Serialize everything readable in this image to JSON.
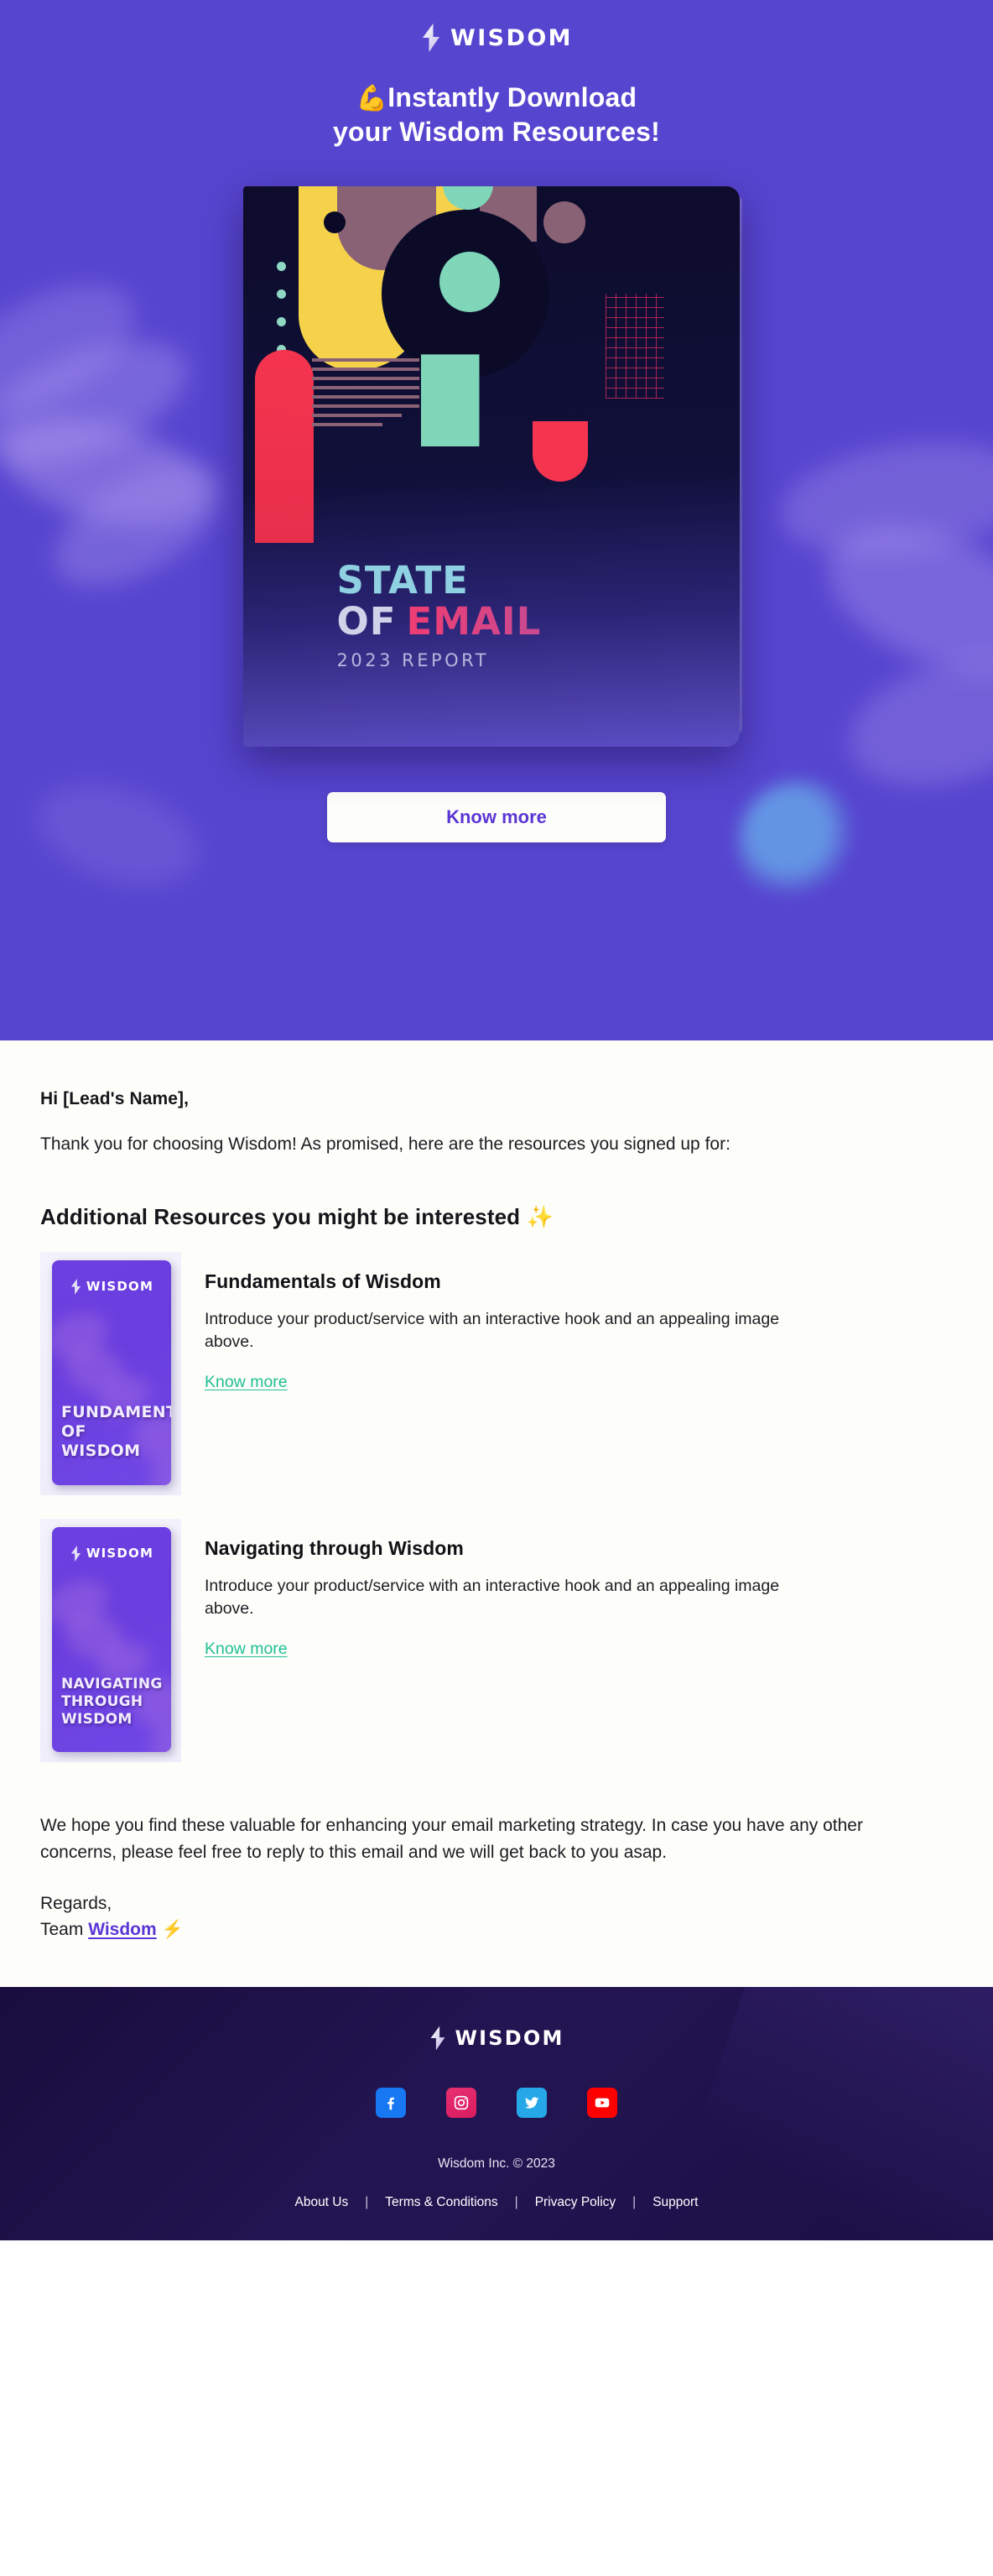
{
  "brand": {
    "name": "WISDOM",
    "accent": "#5645cf",
    "cta_text_color": "#5b36d6",
    "link_green": "#1fbf93",
    "footer_bg": "#1d1046"
  },
  "hero": {
    "logo_word": "WISDOM",
    "logo_icon": "lightning-bolt-icon",
    "headline_emoji": "💪",
    "headline_line1": "Instantly Download",
    "headline_line2": "your Wisdom Resources!",
    "book": {
      "title_line1": "STATE",
      "title_of": "OF",
      "title_email": "EMAIL",
      "subtitle": "2023 REPORT"
    },
    "cta_label": "Know more"
  },
  "body": {
    "greeting": "Hi [Lead's Name],",
    "intro": "Thank you for choosing Wisdom! As promised, here are the resources you signed up for:",
    "section_heading": "Additional Resources you might be interested",
    "section_heading_emoji": "✨",
    "resources": [
      {
        "thumb_logo_word": "WISDOM",
        "thumb_title_line1": "FUNDAMENTALS",
        "thumb_title_line2": "OF WISDOM",
        "title": "Fundamentals of Wisdom",
        "description": "Introduce your product/service with an interactive hook and an appealing image above.",
        "link_label": "Know more"
      },
      {
        "thumb_logo_word": "WISDOM",
        "thumb_title_line1": "NAVIGATING",
        "thumb_title_line2": "THROUGH WISDOM",
        "title": "Navigating through Wisdom",
        "description": "Introduce your product/service with an interactive hook and an appealing image above.",
        "link_label": "Know more"
      }
    ],
    "outro": "We hope you find these valuable for enhancing your email marketing strategy. In case you have any other concerns, please feel free to reply to this email and we will get back to you asap.",
    "signoff_regards": "Regards,",
    "signoff_team_prefix": "Team ",
    "signoff_team_link": "Wisdom",
    "signoff_emoji": "⚡"
  },
  "footer": {
    "logo_word": "WISDOM",
    "socials": [
      {
        "name": "facebook-icon",
        "label": "Facebook"
      },
      {
        "name": "instagram-icon",
        "label": "Instagram"
      },
      {
        "name": "twitter-icon",
        "label": "Twitter"
      },
      {
        "name": "youtube-icon",
        "label": "YouTube"
      }
    ],
    "copyright": "Wisdom Inc. © 2023",
    "links": [
      "About Us",
      "Terms & Conditions",
      "Privacy Policy",
      "Support"
    ],
    "separator": "|"
  }
}
